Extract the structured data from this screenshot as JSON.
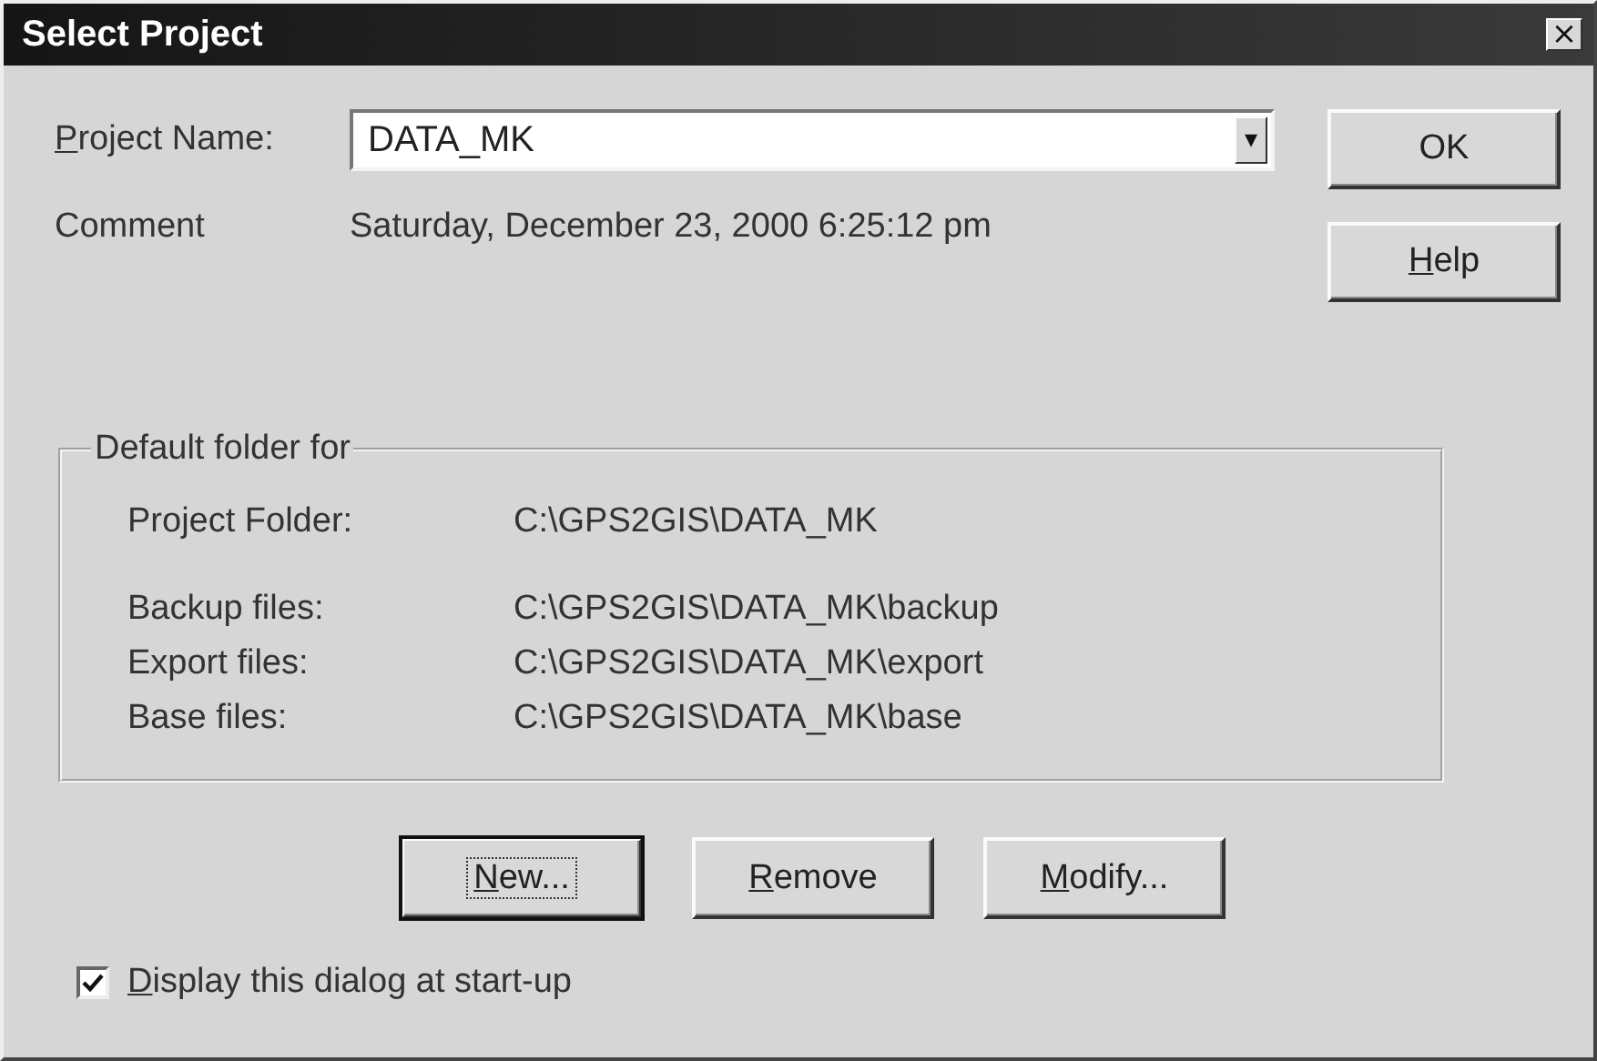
{
  "window": {
    "title": "Select Project",
    "close": "×"
  },
  "project_name": {
    "mnemonic": "P",
    "label_rest": "roject Name:",
    "value": "DATA_MK",
    "arrow": "▾"
  },
  "comment": {
    "label": "Comment",
    "value": "Saturday, December 23, 2000 6:25:12 pm"
  },
  "side_buttons": [
    {
      "label_rest": "OK",
      "default": false
    },
    {
      "mnemonic": "H",
      "label_rest": "elp",
      "default": false
    }
  ],
  "group": {
    "title": "Default folder for",
    "rows": [
      {
        "label": "Project Folder:",
        "value": "C:\\GPS2GIS\\DATA_MK"
      },
      {
        "label": "Backup files:",
        "value": "C:\\GPS2GIS\\DATA_MK\\backup"
      },
      {
        "label": "Export files:",
        "value": "C:\\GPS2GIS\\DATA_MK\\export"
      },
      {
        "label": "Base files:",
        "value": "C:\\GPS2GIS\\DATA_MK\\base"
      }
    ]
  },
  "bottom_buttons": [
    {
      "mnemonic": "N",
      "label_rest": "ew...",
      "default": true
    },
    {
      "mnemonic": "R",
      "label_rest": "emove",
      "default": false
    },
    {
      "mnemonic": "M",
      "label_rest": "odify...",
      "default": false
    }
  ],
  "startup_checkbox": {
    "mnemonic": "D",
    "label_rest": "isplay this dialog at start-up",
    "checked": true
  }
}
